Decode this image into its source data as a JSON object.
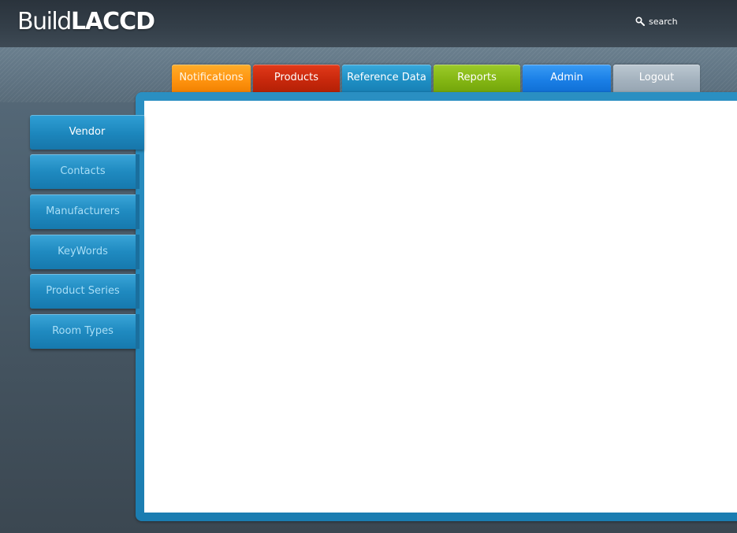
{
  "header": {
    "logo_light": "Build",
    "logo_bold": "LACCD",
    "search_label": "search"
  },
  "tabs": [
    {
      "label": "Notifications",
      "color": "#ff9410"
    },
    {
      "label": "Products",
      "color": "#c8280c"
    },
    {
      "label": "Reference Data",
      "color": "#1e8fc4",
      "selected": true
    },
    {
      "label": "Reports",
      "color": "#84b614"
    },
    {
      "label": "Admin",
      "color": "#1a7fe6"
    },
    {
      "label": "Logout",
      "color": "#a4b2be"
    }
  ],
  "sidebar": {
    "items": [
      {
        "label": "Vendor",
        "active": true
      },
      {
        "label": "Contacts"
      },
      {
        "label": "Manufacturers"
      },
      {
        "label": "KeyWords"
      },
      {
        "label": "Product Series"
      },
      {
        "label": "Room Types"
      }
    ]
  },
  "colors": {
    "accent_blue": "#1b7db1",
    "panel_background": "#ffffff",
    "page_background": "#4e6170"
  }
}
